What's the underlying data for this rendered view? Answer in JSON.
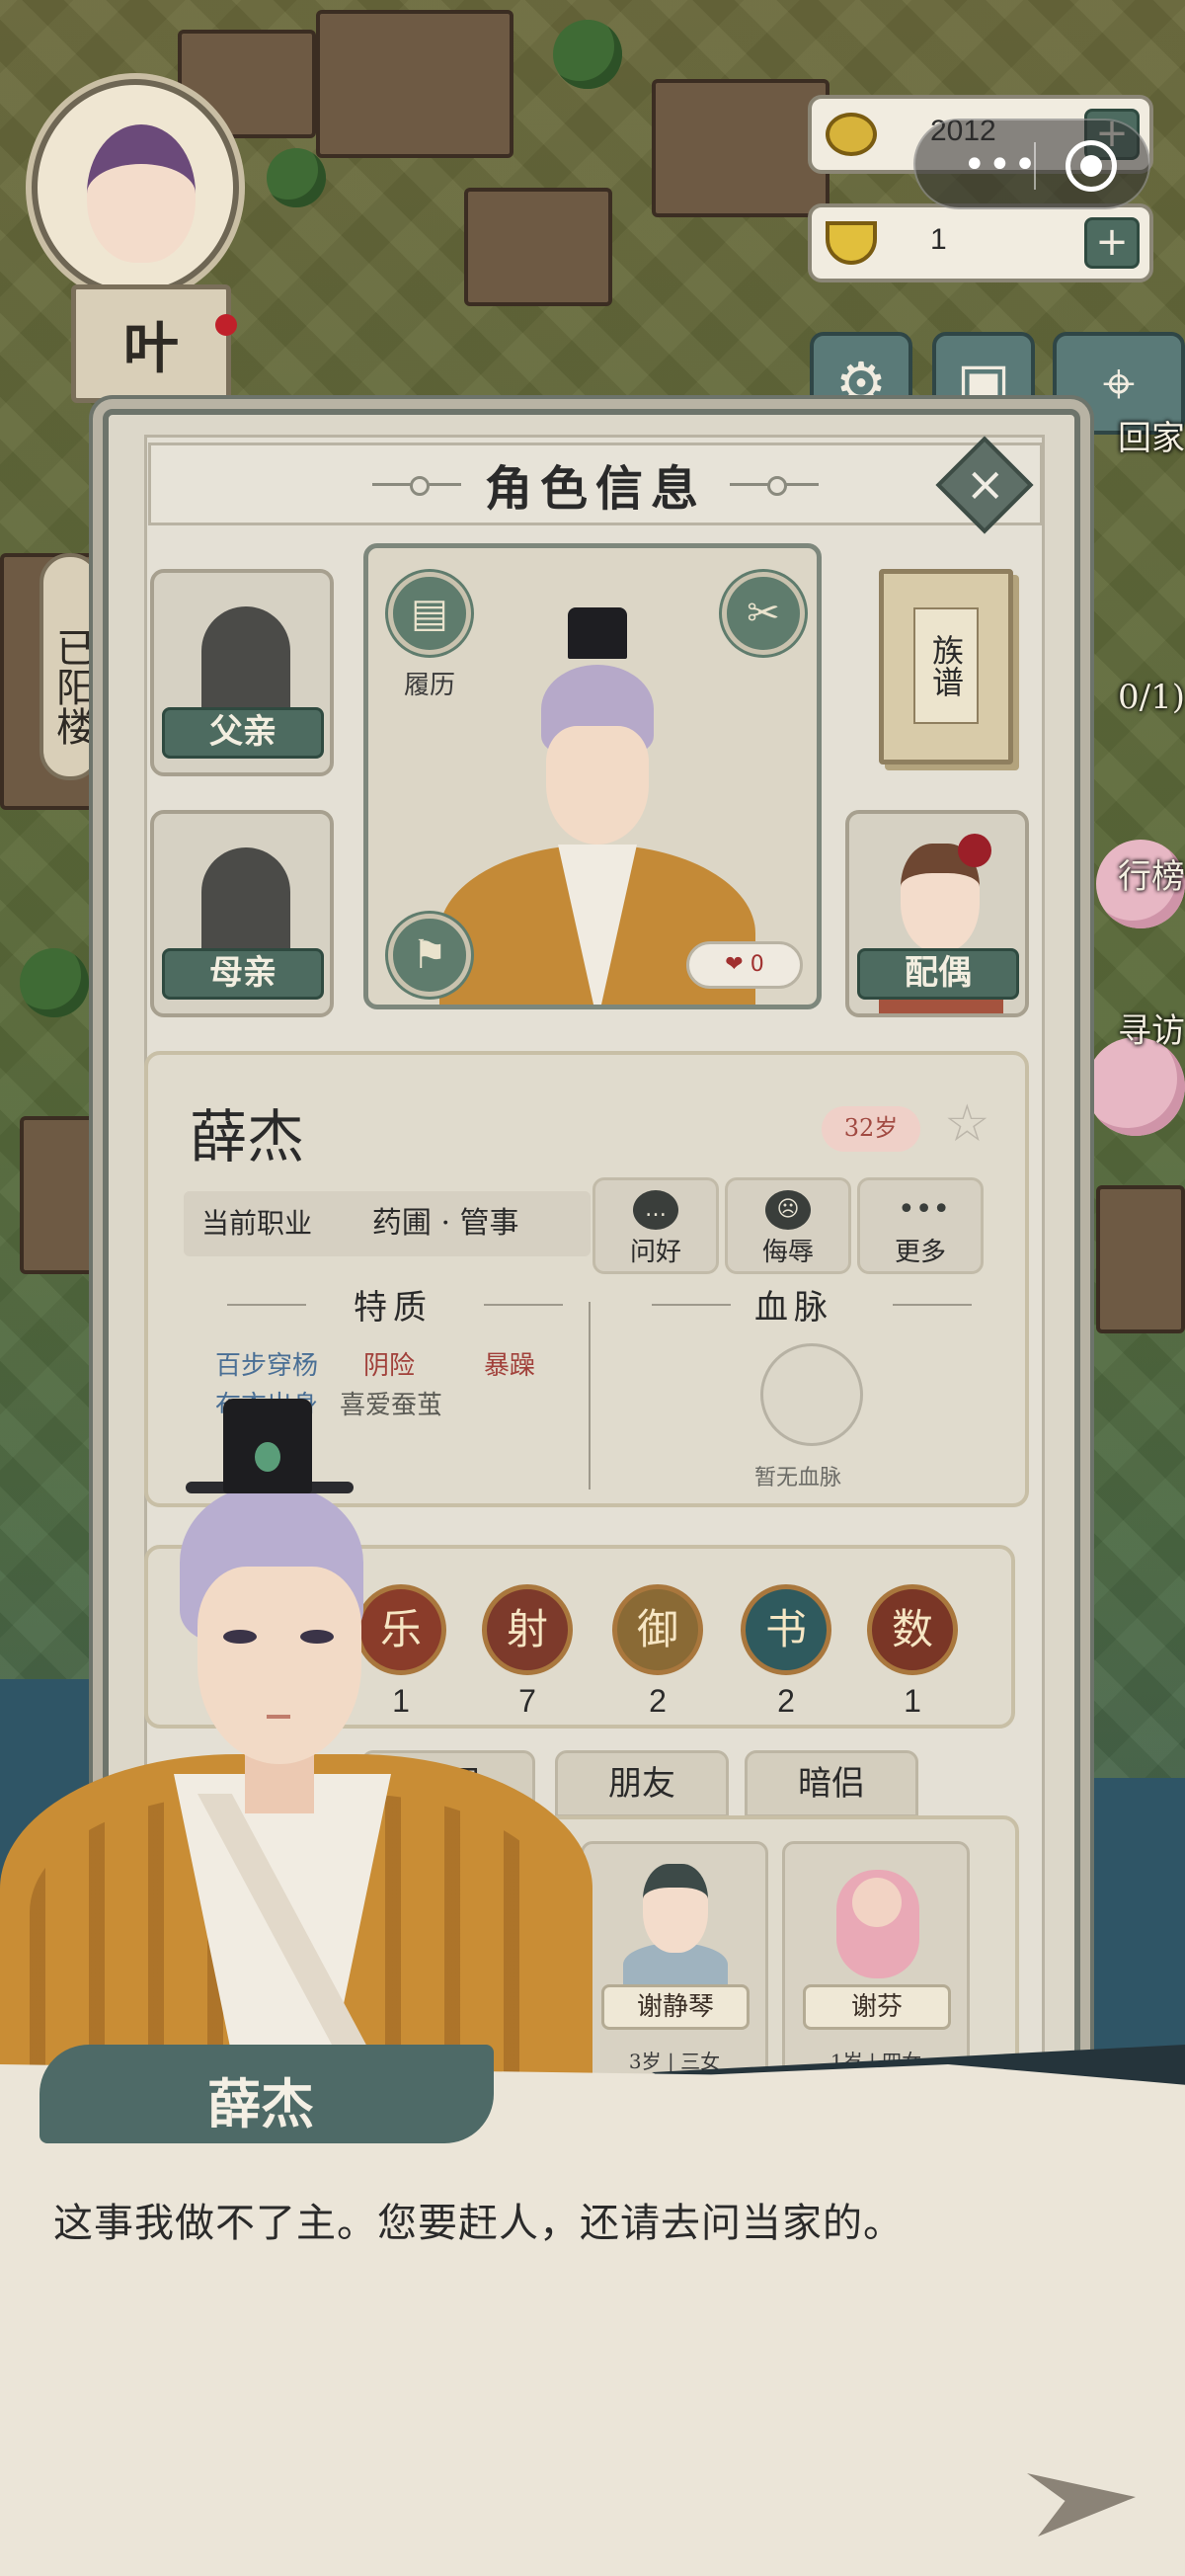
{
  "hud": {
    "player_name": "叶",
    "side_text": "已阳楼",
    "coins": "2012",
    "ingots": "1",
    "plus_symbol": "+",
    "home_label": "回家",
    "rank_label": "行榜",
    "visit_label": "寻访",
    "counter_label": "0/1)"
  },
  "panel": {
    "title": "角色信息",
    "close_symbol": "×",
    "father_label": "父亲",
    "mother_label": "母亲",
    "spouse_label": "配偶",
    "resume_label": "履历",
    "genealogy_label": "族谱",
    "likes": "0",
    "character": {
      "name": "薛杰",
      "age": "32岁",
      "job_label": "当前职业",
      "job_value": "药圃 · 管事"
    },
    "actions": [
      {
        "label": "问好"
      },
      {
        "label": "侮辱"
      },
      {
        "label": "更多"
      }
    ],
    "traits_heading": "特质",
    "traits": [
      "百步穿杨",
      "阴险",
      "暴躁",
      "布衣出身",
      "喜爱蚕茧"
    ],
    "bloodline_heading": "血脉",
    "bloodline_value": "暂无血脉",
    "skills": [
      {
        "glyph": "乐",
        "value": "1"
      },
      {
        "glyph": "射",
        "value": "7"
      },
      {
        "glyph": "御",
        "value": "2"
      },
      {
        "glyph": "书",
        "value": "2"
      },
      {
        "glyph": "数",
        "value": "1"
      }
    ],
    "tabs": [
      "手足",
      "朋友",
      "暗侣"
    ],
    "children": [
      {
        "name": "谢静琴",
        "age": "3岁",
        "rank": "三女"
      },
      {
        "name": "谢芬",
        "age": "1岁",
        "rank": "四女"
      }
    ]
  },
  "dialog": {
    "speaker": "薛杰",
    "text": "这事我做不了主。您要赶人，还请去问当家的。"
  },
  "colors": {
    "accent_green": "#4d6b60",
    "panel_bg": "#dcd7c9",
    "trait_blue": "#4a6f95",
    "trait_red": "#a1403a"
  }
}
